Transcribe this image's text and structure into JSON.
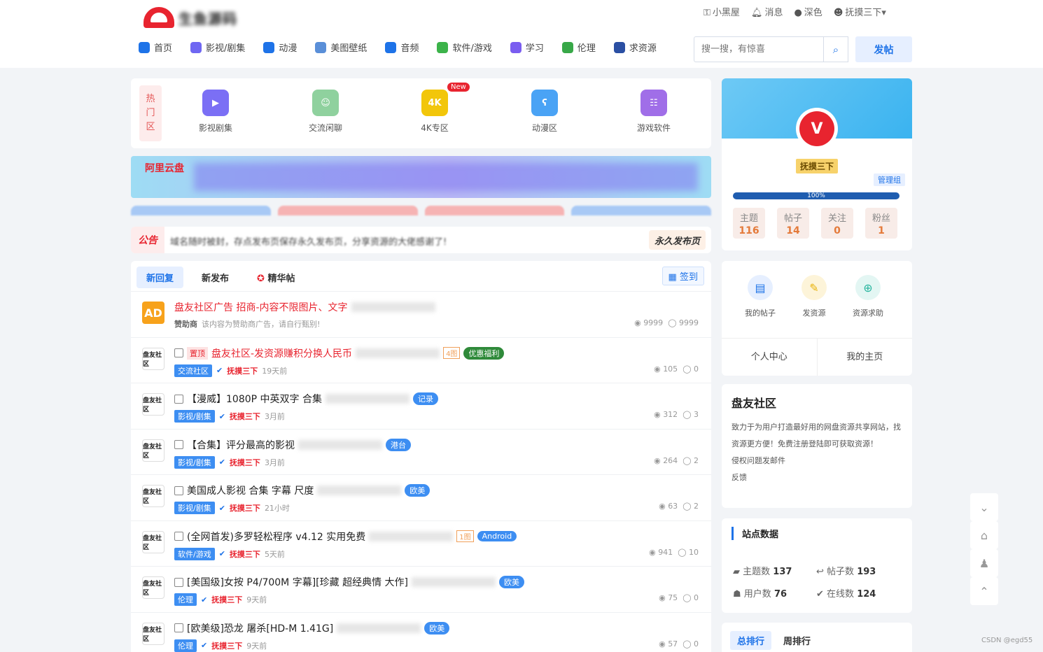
{
  "header": {
    "logo_text": "生鱼源码",
    "top_links": [
      {
        "icon": "key-icon",
        "label": "小黑屋"
      },
      {
        "icon": "bell-icon",
        "label": "消息"
      },
      {
        "icon": "moon-icon",
        "label": "深色"
      },
      {
        "icon": "user-icon",
        "label": "抚摸三下"
      }
    ],
    "nav": [
      {
        "icon": "home-icon",
        "label": "首页",
        "color": "#1e73e8"
      },
      {
        "icon": "video-icon",
        "label": "影视/剧集",
        "color": "#6f67f2"
      },
      {
        "icon": "cartoon-icon",
        "label": "动漫",
        "color": "#1e73e8"
      },
      {
        "icon": "image-icon",
        "label": "美图壁纸",
        "color": "#5a8fd8"
      },
      {
        "icon": "headphone-icon",
        "label": "音频",
        "color": "#1e73e8"
      },
      {
        "icon": "apps-icon",
        "label": "软件/游戏",
        "color": "#3cb34a"
      },
      {
        "icon": "book-icon",
        "label": "学习",
        "color": "#7a5df0"
      },
      {
        "icon": "leaf-icon",
        "label": "伦理",
        "color": "#38a848"
      },
      {
        "icon": "stamp-icon",
        "label": "求资源",
        "color": "#2b4fa3"
      }
    ],
    "search_placeholder": "搜一搜，有惊喜",
    "post_button": "发帖"
  },
  "hot_zone": {
    "tag": "热门区",
    "items": [
      {
        "icon": "video-camera-icon",
        "label": "影视剧集",
        "bg": "#7b6ff5",
        "glyph": "▶"
      },
      {
        "icon": "wechat-icon",
        "label": "交流闲聊",
        "bg": "#8fd19e",
        "glyph": "☺"
      },
      {
        "icon": "4k-icon",
        "label": "4K专区",
        "bg": "#f2c60a",
        "glyph": "4K",
        "badge": "New"
      },
      {
        "icon": "bear-icon",
        "label": "动漫区",
        "bg": "#4aa3f5",
        "glyph": "ʕ"
      },
      {
        "icon": "gamepad-icon",
        "label": "游戏软件",
        "bg": "#a06ee8",
        "glyph": "☷"
      }
    ]
  },
  "banner": {
    "text": "阿里云盘"
  },
  "notice": {
    "label": "公告",
    "text": "域名随时被封，存点发布页保存永久发布页，分享资源的大佬感谢了!",
    "permanent": "永久发布页"
  },
  "list": {
    "tabs": [
      "新回复",
      "新发布",
      "精华帖"
    ],
    "signin": "签到",
    "rows": [
      {
        "ad": true,
        "avatar": "AD",
        "title": "盘友社区广告 招商-内容不限图片、文字",
        "author": "赞助商",
        "meta": "该内容为赞助商广告，请自行甄别!",
        "views": "9999",
        "replies": "9999",
        "red": true
      },
      {
        "tag": "置顶",
        "title": "盘友社区-发资源赚积分换人民币",
        "extra": "4图",
        "badge": "优惠福利",
        "cat": "交流社区",
        "author": "抚摸三下",
        "time": "19天前",
        "views": "105",
        "replies": "0",
        "red": true
      },
      {
        "title": "【漫威】1080P 中英双字 合集",
        "badge": "记录",
        "cat": "影视/剧集",
        "author": "抚摸三下",
        "time": "3月前",
        "views": "312",
        "replies": "3"
      },
      {
        "title": "【合集】评分最高的影视",
        "badge": "港台",
        "cat": "影视/剧集",
        "author": "抚摸三下",
        "time": "3月前",
        "views": "264",
        "replies": "2"
      },
      {
        "title": "美国成人影视 合集 字幕 尺度",
        "badge": "欧美",
        "cat": "影视/剧集",
        "author": "抚摸三下",
        "time": "21小时",
        "views": "63",
        "replies": "2"
      },
      {
        "title": "(全网首发)多罗轻松程序 v4.12 实用免费",
        "extra": "1图",
        "badge": "Android",
        "cat": "软件/游戏",
        "author": "抚摸三下",
        "time": "5天前",
        "views": "941",
        "replies": "10"
      },
      {
        "title": "[美国级]女按 P4/700M 字幕][珍藏 超经典情 大作]",
        "badge": "欧美",
        "cat": "伦理",
        "author": "抚摸三下",
        "time": "9天前",
        "views": "75",
        "replies": "0"
      },
      {
        "title": "[欧美级]恐龙 屠杀[HD-M 1.41G]",
        "badge": "欧美",
        "cat": "伦理",
        "author": "抚摸三下",
        "time": "9天前",
        "views": "57",
        "replies": "0"
      }
    ]
  },
  "profile": {
    "name": "抚摸三下",
    "group": "管理组",
    "progress": "100%",
    "counts": [
      {
        "label": "主题",
        "value": "116"
      },
      {
        "label": "帖子",
        "value": "14"
      },
      {
        "label": "关注",
        "value": "0"
      },
      {
        "label": "粉丝",
        "value": "1"
      }
    ]
  },
  "quick": {
    "items": [
      {
        "icon": "post-icon",
        "label": "我的帖子"
      },
      {
        "icon": "edit-icon",
        "label": "发资源"
      },
      {
        "icon": "help-icon",
        "label": "资源求助"
      }
    ],
    "links": [
      "个人中心",
      "我的主页"
    ]
  },
  "about": {
    "title": "盘友社区",
    "desc": "致力于为用户打造最好用的网盘资源共享网站，找资源更方便！免费注册登陆即可获取资源！",
    "contact": "侵权问题发邮件",
    "feedback": "反馈"
  },
  "site_data": {
    "title": "站点数据",
    "topics_label": "主题数",
    "topics": "137",
    "posts_label": "帖子数",
    "posts": "193",
    "users_label": "用户数",
    "users": "76",
    "online_label": "在线数",
    "online": "124"
  },
  "rank": {
    "total": "总排行",
    "week": "周排行"
  },
  "watermark": "CSDN @egd55"
}
